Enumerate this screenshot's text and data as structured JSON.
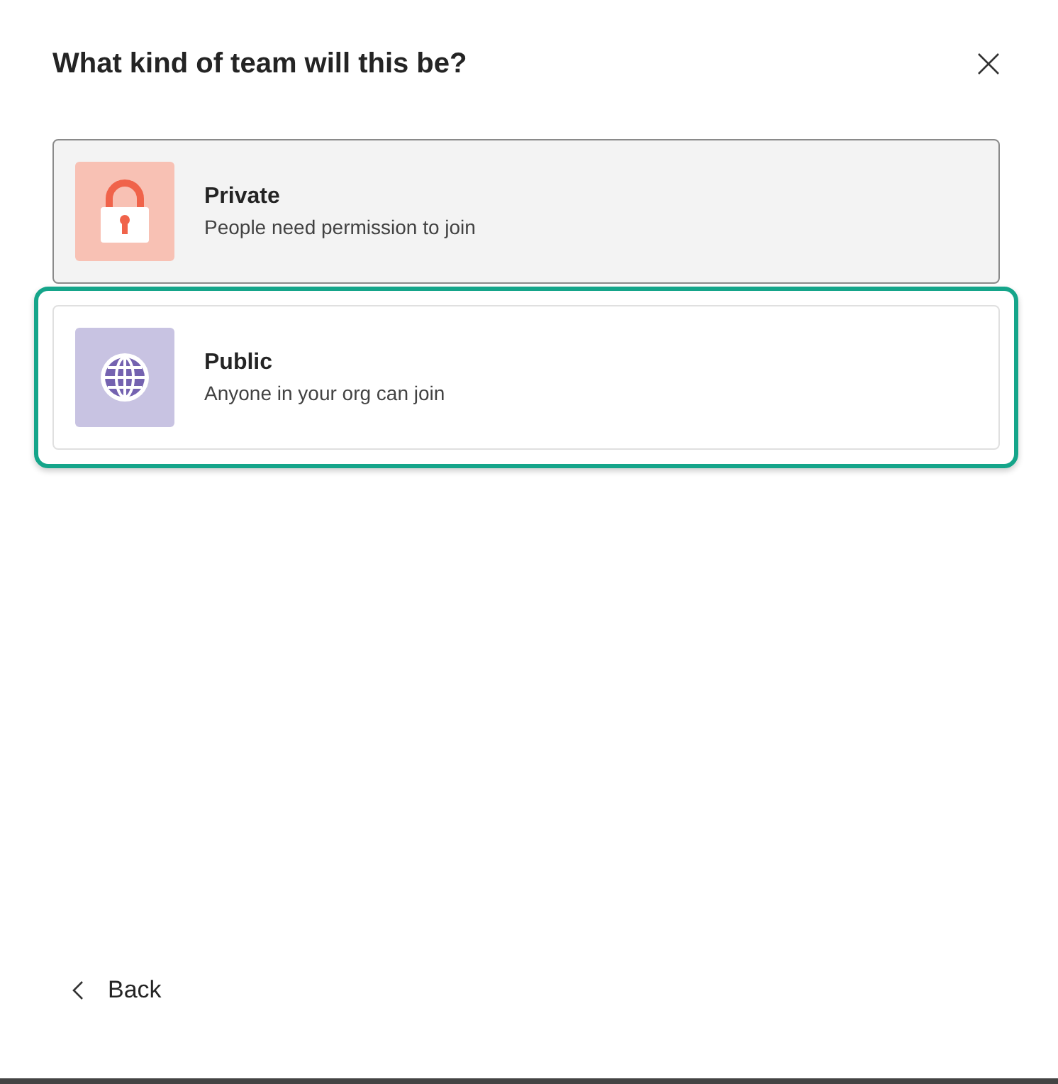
{
  "dialog": {
    "title": "What kind of team will this be?"
  },
  "options": [
    {
      "kind": "lock",
      "title": "Private",
      "description": "People need permission to join",
      "highlighted": true,
      "selected": false
    },
    {
      "kind": "globe",
      "title": "Public",
      "description": "Anyone in your org can join",
      "highlighted": false,
      "selected": true
    }
  ],
  "footer": {
    "back_label": "Back"
  }
}
